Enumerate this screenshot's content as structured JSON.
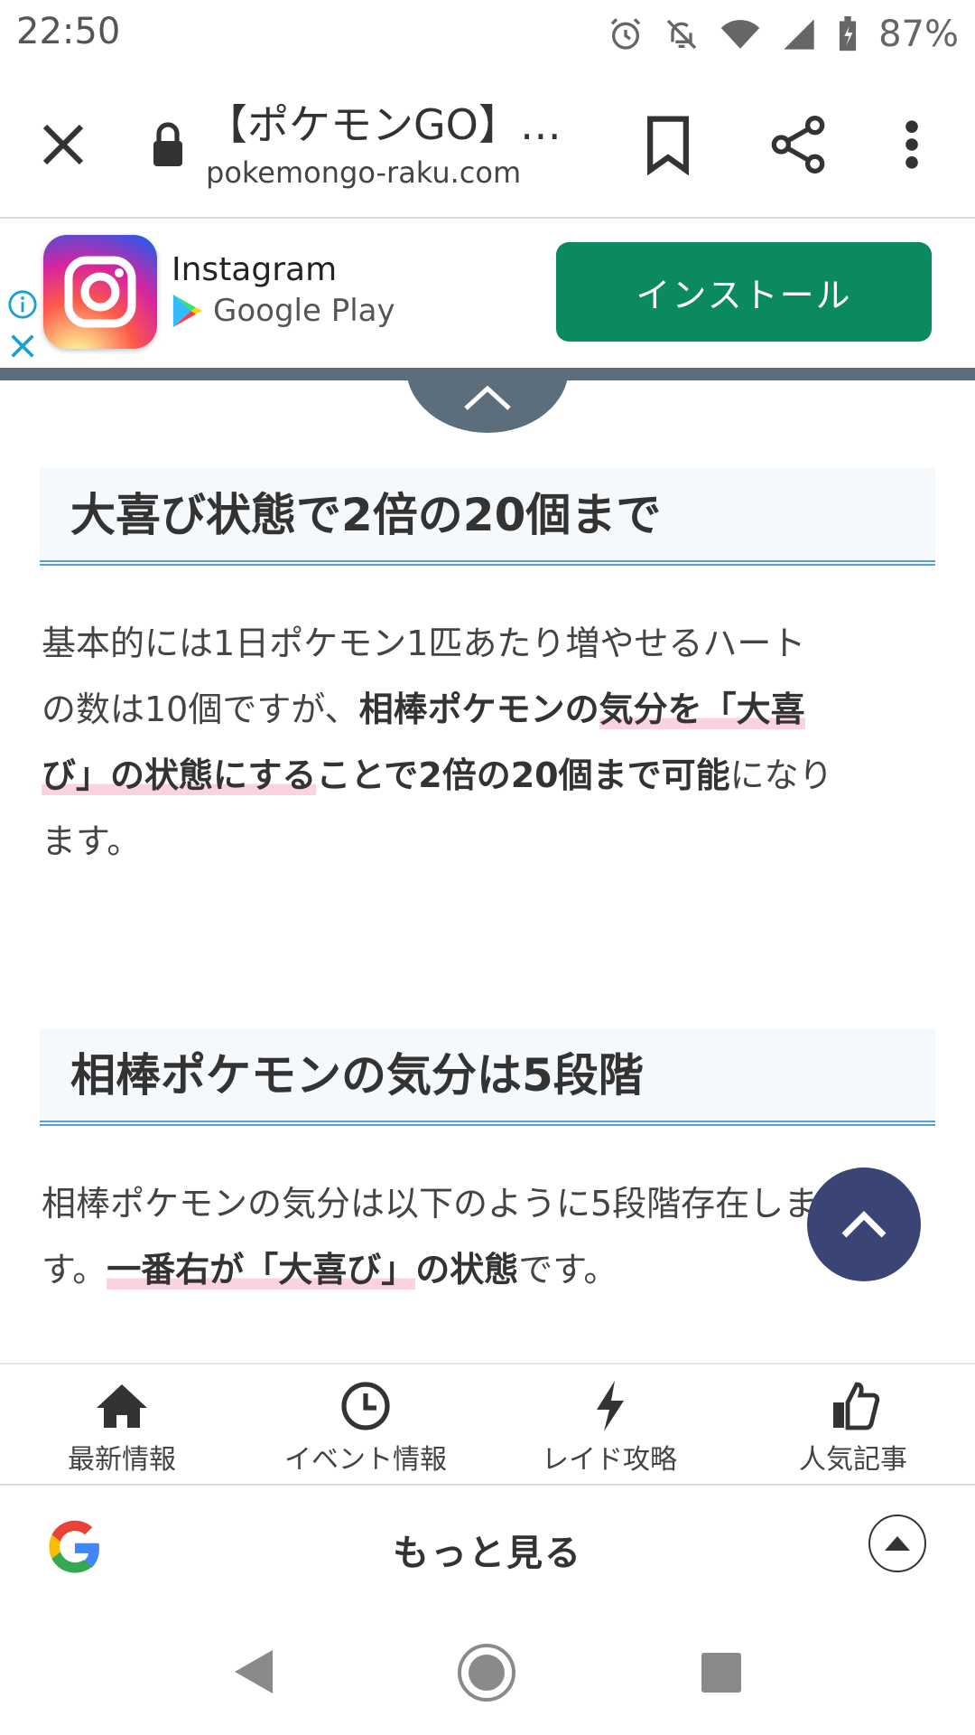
{
  "status_bar": {
    "time": "22:50",
    "battery": "87%",
    "icons": [
      "alarm-icon",
      "notifications-off-icon",
      "wifi-icon",
      "signal-icon",
      "battery-charging-icon"
    ]
  },
  "toolbar": {
    "title": "【ポケモンGO】…",
    "url": "pokemongo-raku.com"
  },
  "ad": {
    "app_name": "Instagram",
    "store": "Google Play",
    "install_label": "インストール"
  },
  "sections": [
    {
      "heading": "大喜び状態で2倍の20個まで",
      "p_1": "基本的には1日ポケモン1匹あたり増やせるハート",
      "p_2": "の数は10個ですが、",
      "p_3_bold": "相棒ポケモンの",
      "p_4_hl": "気分を「大喜",
      "p_5_hl": "び」の状態にする",
      "p_6_bold": "ことで2倍の20個まで可能",
      "p_7": "になり",
      "p_8": "ます。"
    },
    {
      "heading": "相棒ポケモンの気分は5段階",
      "p_1": "相棒ポケモンの気分は以下のように5段階存在しま",
      "p_2": "す。",
      "p_3_hl": "一番右が「大喜び」",
      "p_4_bold": "の状態",
      "p_5": "です。"
    }
  ],
  "bottom_nav": [
    {
      "label": "最新情報",
      "icon": "home-icon"
    },
    {
      "label": "イベント情報",
      "icon": "clock-icon"
    },
    {
      "label": "レイド攻略",
      "icon": "lightning-icon"
    },
    {
      "label": "人気記事",
      "icon": "thumbs-up-icon"
    }
  ],
  "google_bar": {
    "more_label": "もっと見る"
  }
}
